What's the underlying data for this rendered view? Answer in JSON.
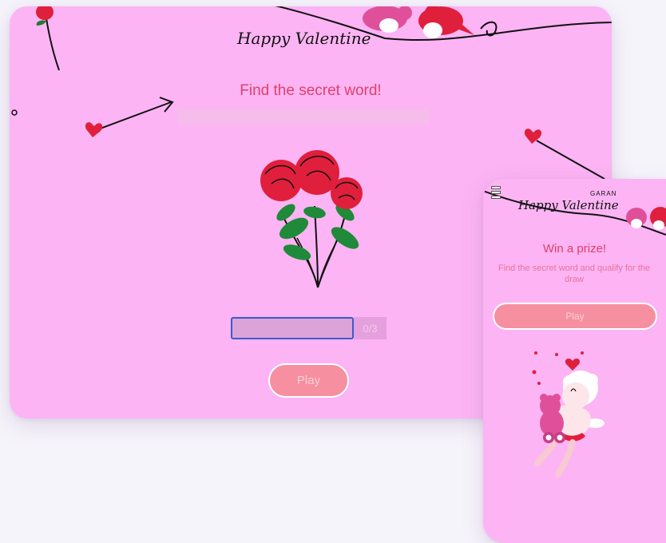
{
  "desktop": {
    "banner_text": "Happy Valentine",
    "title": "Find the secret word!",
    "answer": {
      "value": "",
      "placeholder": ""
    },
    "attempts": "0/3",
    "play_label": "Play"
  },
  "mobile": {
    "banner_text": "Happy Valentine",
    "brand": "GARAN",
    "title": "Win a prize!",
    "subtitle": "Find the secret word and qualify for the draw",
    "play_label": "Play"
  },
  "icons": [
    "menu-icon",
    "rose-bouquet-icon",
    "love-birds-icon",
    "heart-arrow-icon",
    "cupid-teddy-icon",
    "heart-icon"
  ],
  "colors": {
    "background": "#fcb4f4",
    "accent": "#e0406a",
    "button": "#f68fa0",
    "input_border": "#3b5bd1"
  }
}
